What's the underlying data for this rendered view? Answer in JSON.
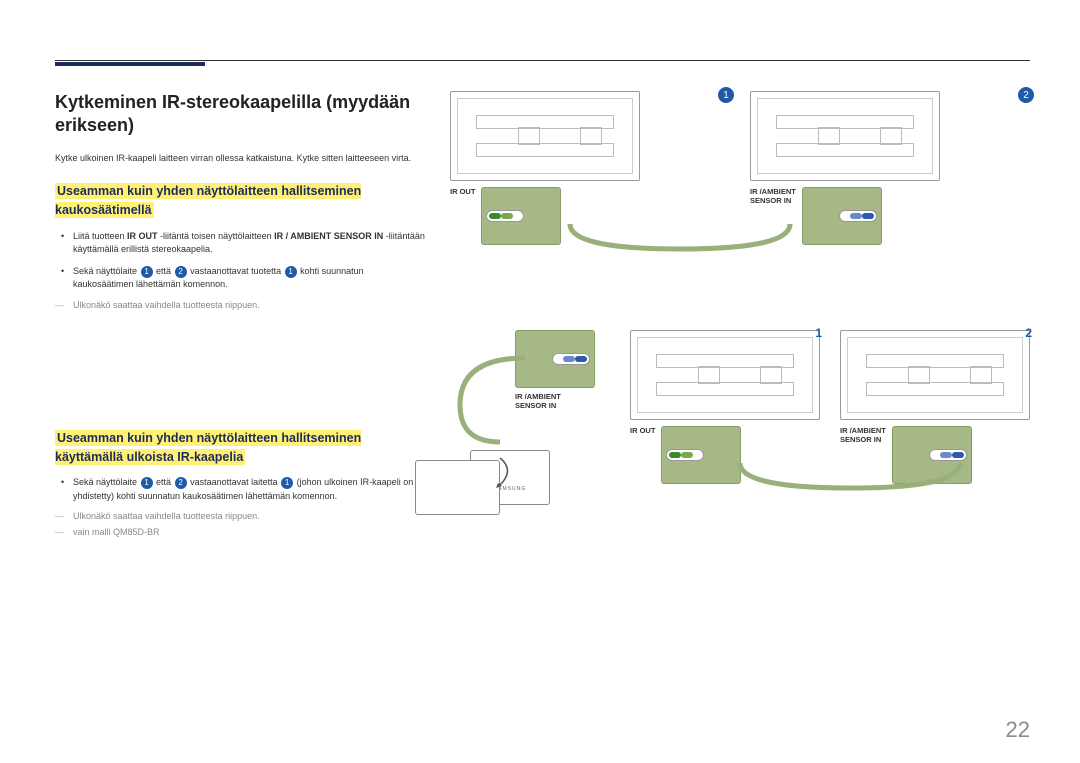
{
  "page_number": "22",
  "title": "Kytkeminen IR-stereokaapelilla (myydään erikseen)",
  "intro": "Kytke ulkoinen IR-kaapeli laitteen virran ollessa katkaistuna. Kytke sitten laitteeseen virta.",
  "section1": {
    "heading": "Useamman kuin yhden näyttölaitteen hallitseminen kaukosäätimellä",
    "bullets": [
      {
        "pre": "Liitä tuotteen ",
        "b1": "IR OUT",
        "mid2": " -liitäntä toisen näyttölaitteen ",
        "b2": "IR / AMBIENT SENSOR IN",
        "post": " -liitäntään käyttämällä erillistä stereokaapelia."
      },
      {
        "pre": "Sekä näyttölaite ",
        "ref1": "1",
        "mid1": " että ",
        "ref2": "2",
        "mid2": " vastaanottavat tuotetta ",
        "ref3": "1",
        "post": " kohti suunnatun kaukosäätimen lähettämän komennon."
      }
    ],
    "note": "Ulkonäkö saattaa vaihdella tuotteesta riippuen."
  },
  "section2": {
    "heading": "Useamman kuin yhden näyttölaitteen hallitseminen käyttämällä ulkoista IR-kaapelia",
    "bullets": [
      {
        "pre": "Sekä näyttölaite ",
        "ref1": "1",
        "mid1": " että ",
        "ref2": "2",
        "mid2": " vastaanottavat laitetta ",
        "ref3": "1",
        "post": " (johon ulkoinen IR-kaapeli on yhdistetty) kohti suunnatun kaukosäätimen lähettämän komennon."
      }
    ],
    "note1": "Ulkonäkö saattaa vaihdella tuotteesta riippuen.",
    "note2": "vain malli QM85D-BR"
  },
  "labels": {
    "ir_out": "IR OUT",
    "ir_ambient": "IR /AMBIENT",
    "sensor_in": "SENSOR IN",
    "badge1": "1",
    "badge2": "2",
    "samsung": "SAMSUNG"
  }
}
